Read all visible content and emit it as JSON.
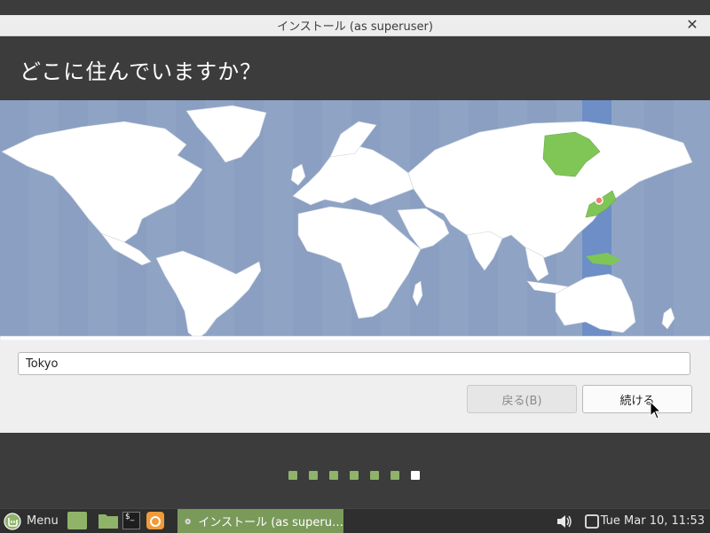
{
  "window": {
    "title": "インストール (as superuser)"
  },
  "header": {
    "title": "どこに住んでいますか？"
  },
  "map": {
    "selected_city": "Tokyo",
    "highlight_color": "#7fc657",
    "band_color": "#6d8ec6"
  },
  "timezone": {
    "value": "Tokyo"
  },
  "buttons": {
    "back_label": "戻る(B)",
    "next_label": "続ける"
  },
  "progress": {
    "total_steps": 7,
    "current_step": 7
  },
  "taskbar": {
    "menu_label": "Menu",
    "window_label": "インストール (as superu…",
    "clock": "Tue Mar 10, 11:53",
    "launchers": [
      "show-desktop-icon",
      "files-icon",
      "terminal-icon",
      "firefox-icon"
    ],
    "tray": [
      "volume-icon",
      "notifications-icon"
    ]
  }
}
